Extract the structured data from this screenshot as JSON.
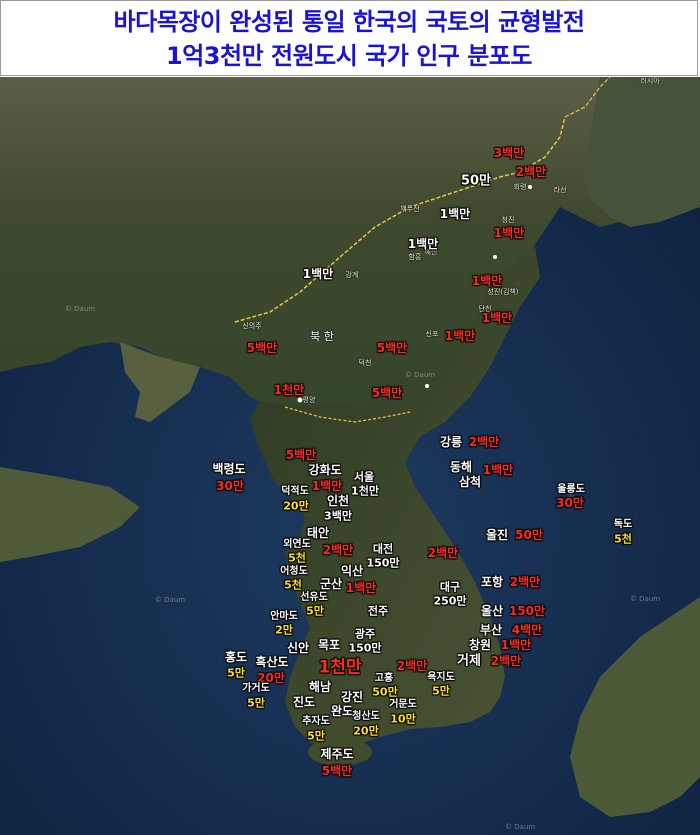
{
  "title": {
    "line1": "바다목장이 완성된 통일 한국의 국토의 균형발전",
    "line2": "1억3천만 전원도시 국가 인구 분포도"
  },
  "map_labels": {
    "russia": "러시아",
    "sea_east": "동해 (Sea of Japan)",
    "north_korea": "북 한",
    "watermark": "© Daum"
  },
  "base_places": {
    "hoeryong": "회령",
    "rason": "라선",
    "cheongjin": "청진",
    "gimchaek": "성진(김책)",
    "danchon": "단천",
    "sinpo": "신포",
    "hamheung": "함흥",
    "sinuiju": "신의주",
    "ganggye": "강계",
    "pyeongyang": "평양",
    "deokcheon": "덕천",
    "wonsan": "원산",
    "baekdusan": "백두산",
    "hyesan": "혜산"
  },
  "labels": {
    "rason_3m": "3백만",
    "rason_2m": "2백만",
    "hoeryong_500k": "50만",
    "baekdu_1m": "1백만",
    "hyesan_1m": "1백만",
    "cheongjin_1m": "1백만",
    "ganggye_1m": "1백만",
    "gimchaek_1m": "1백만",
    "danchon_1m": "1백만",
    "sinpo_1m": "1백만",
    "sinuiju_5m": "5백만",
    "hamheung_5m": "5백만",
    "pyeongyang_10m": "1천만",
    "wonsan_5m": "5백만",
    "gangreung_name": "강릉",
    "gangreung_val": "2백만",
    "donghae_name": "동해",
    "samcheok_name": "삼척",
    "donghae_val": "1백만",
    "ulleung_name": "울릉도",
    "ulleung_val": "30만",
    "dokdo_name": "독도",
    "dokdo_val": "5천",
    "baengnyeong_name": "백령도",
    "baengnyeong_val": "30만",
    "haeju_5m": "5백만",
    "ganghwa_name": "강화도",
    "ganghwa_val": "1백만",
    "deokjeok_name": "덕적도",
    "deokjeok_val": "20만",
    "seoul_name": "서울",
    "seoul_val": "1천만",
    "incheon_name": "인천",
    "incheon_val": "3백만",
    "taean_name": "태안",
    "taean_val": "2백만",
    "oeyeon_name": "외연도",
    "oeyeon_val": "5천",
    "daejeon_name": "대전",
    "daejeon_val": "150만",
    "central_2m": "2백만",
    "uljin_name": "울진",
    "uljin_val": "50만",
    "eocheong_name": "어청도",
    "eocheong_val": "5천",
    "iksan_name": "익산",
    "gunsan_name": "군산",
    "gunsan_val": "1백만",
    "daegu_name": "대구",
    "daegu_val": "250만",
    "pohang_name": "포항",
    "pohang_val": "2백만",
    "seonyu_name": "선유도",
    "seonyu_val": "5만",
    "jeonju_name": "전주",
    "anma_name": "안마도",
    "anma_val": "2만",
    "ulsan_name": "울산",
    "ulsan_val": "150만",
    "busan_name": "부산",
    "busan_val": "4백만",
    "gwangju_name": "광주",
    "gwangju_val": "150만",
    "mokpo_name": "목포",
    "sinan_name": "신안",
    "changwon_name": "창원",
    "changwon_val": "1백만",
    "hong_name": "홍도",
    "hong_val": "5만",
    "heuksan_name": "흑산도",
    "heuksan_val": "20만",
    "southwest_10m": "1천만",
    "suncheon_2m": "2백만",
    "geoje_name": "거제",
    "geoje_val": "2백만",
    "goheung_name": "고흥",
    "goheung_val": "50만",
    "yokji_name": "욕지도",
    "yokji_val": "5만",
    "gageo_name": "가거도",
    "gageo_val": "5만",
    "jindo_name": "진도",
    "haenam_name": "해남",
    "gangjin_name": "강진",
    "wando_name": "완도",
    "geomun_name": "거문도",
    "geomun_val": "10만",
    "chuja_name": "추자도",
    "chuja_val": "5만",
    "cheongsan_name": "청산도",
    "cheongsan_val": "20만",
    "jeju_name": "제주도",
    "jeju_val": "5백만"
  },
  "colors": {
    "title": "#1a13d6",
    "name_text": "#ffffff",
    "red_value": "#ff2a20",
    "yellow_value": "#ffe11a",
    "sea": "#173052",
    "land": "#4e5a3a"
  }
}
